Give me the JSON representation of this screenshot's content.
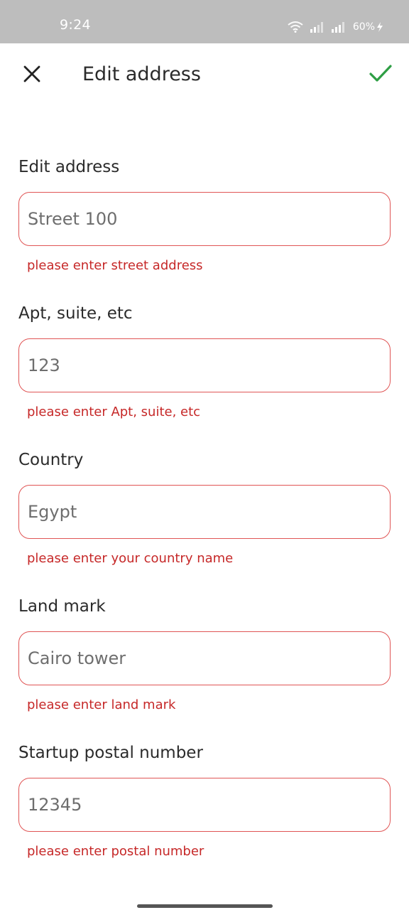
{
  "status_bar": {
    "time": "9:24",
    "battery": "60%",
    "icons": [
      "wifi-icon",
      "signal-icon",
      "signal-icon",
      "battery-charging-icon"
    ]
  },
  "header": {
    "title": "Edit address",
    "close_icon": "close-icon",
    "confirm_icon": "check-icon"
  },
  "colors": {
    "accent_check": "#2e9e44",
    "error": "#c62828",
    "input_border": "#e05555",
    "status_bar": "#bdbdbd"
  },
  "fields": [
    {
      "label": "Edit address",
      "placeholder": "Street 100",
      "value": "",
      "error": "please enter street address"
    },
    {
      "label": "Apt, suite, etc",
      "placeholder": "123",
      "value": "",
      "error": "please enter Apt, suite, etc"
    },
    {
      "label": "Country",
      "placeholder": "Egypt",
      "value": "",
      "error": "please enter your country name"
    },
    {
      "label": "Land mark",
      "placeholder": "Cairo tower",
      "value": "",
      "error": "please enter land mark"
    },
    {
      "label": "Startup postal number",
      "placeholder": "12345",
      "value": "",
      "error": "please enter postal number"
    }
  ]
}
